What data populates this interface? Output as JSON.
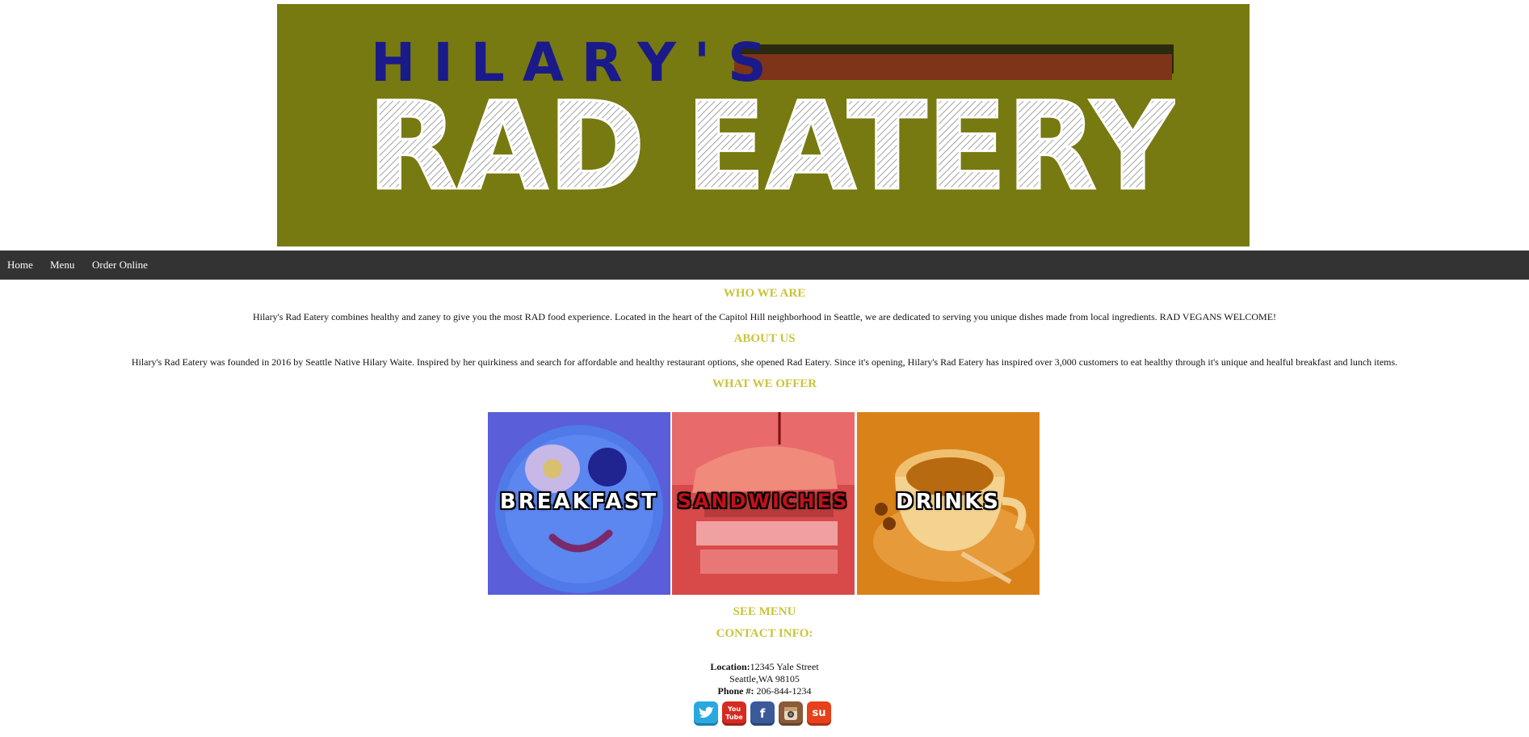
{
  "banner": {
    "brand_small": "HILARY'S",
    "brand_big": "RAD EATERY",
    "bg_color": "#777a10"
  },
  "nav": {
    "items": [
      {
        "label": "Home"
      },
      {
        "label": "Menu"
      },
      {
        "label": "Order Online"
      }
    ]
  },
  "who": {
    "heading": "WHO WE ARE",
    "text": "Hilary's Rad Eatery combines healthy and zaney to give you the most RAD food experience. Located in the heart of the Capitol Hill neighborhood in Seattle, we are dedicated to serving you unique dishes made from local ingredients. RAD VEGANS WELCOME!"
  },
  "about": {
    "heading": "ABOUT US",
    "text": "Hilary's Rad Eatery was founded in 2016 by Seattle Native Hilary Waite. Inspired by her quirkiness and search for affordable and healthy restaurant options, she opened Rad Eatery. Since it's opening, Hilary's Rad Eatery has inspired over 3,000 customers to eat healthy through it's unique and healful breakfast and lunch items."
  },
  "offer": {
    "heading": "WHAT WE OFFER",
    "tiles": [
      {
        "label": "BREAKFAST"
      },
      {
        "label": "SANDWICHES"
      },
      {
        "label": "DRINKS"
      }
    ]
  },
  "see_menu": "SEE MENU",
  "contact": {
    "heading": "CONTACT INFO:",
    "location_label": "Location:",
    "location_line1": "12345 Yale Street",
    "location_line2": "Seattle,WA 98105",
    "phone_label": "Phone #:",
    "phone": "206-844-1234"
  },
  "social": [
    {
      "icon": "twitter-icon",
      "glyph": "t"
    },
    {
      "icon": "youtube-icon",
      "glyph": "You Tube"
    },
    {
      "icon": "facebook-icon",
      "glyph": "f"
    },
    {
      "icon": "instagram-icon",
      "glyph": ""
    },
    {
      "icon": "stumbleupon-icon",
      "glyph": "su"
    }
  ],
  "colors": {
    "accent": "#c9c43a",
    "nav_bg": "#333333",
    "brand_blue": "#1a1a8a",
    "brand_red": "#7e3419"
  }
}
